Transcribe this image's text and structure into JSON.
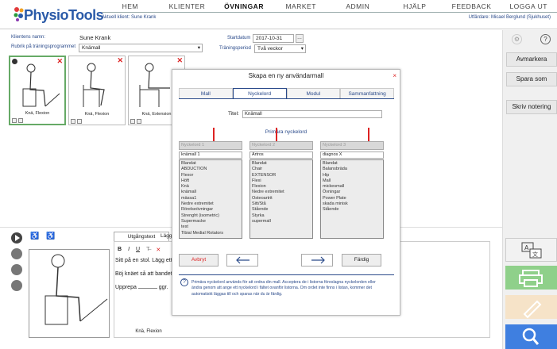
{
  "header": {
    "logo_text": "PhysioTools",
    "nav": [
      "HEM",
      "KLIENTER",
      "ÖVNINGAR",
      "MARKET",
      "ADMIN",
      "HJÄLP",
      "FEEDBACK",
      "LOGGA UT"
    ],
    "active_nav": "ÖVNINGAR",
    "active_client": "Aktuell klient: Sune Krank",
    "performer": "Utfärdare: Micael Berglund (Sjukhuset)"
  },
  "form": {
    "client_name_label": "Klientens namn:",
    "client_name_value": "Sune Krank",
    "title_label": "Rubrik på träningsprogrammet",
    "title_value": "Knämall",
    "start_date_label": "Startdatum",
    "start_date_value": "2017-10-31",
    "period_label": "Träningsperiod",
    "period_value": "Två veckor"
  },
  "cards": [
    {
      "caption": "Knä, Flexion",
      "selected": true
    },
    {
      "caption": "Knä, Flexion",
      "selected": false
    },
    {
      "caption": "Knä, Extension",
      "selected": false
    }
  ],
  "right_panel": {
    "buttons": [
      "Avmarkera",
      "Spara som",
      "Skriv notering"
    ]
  },
  "modal": {
    "title": "Skapa en ny användarmall",
    "close": "×",
    "tabs": [
      "Mall",
      "Nyckelord",
      "Modul",
      "Sammanfattning"
    ],
    "active_tab": "Nyckelord",
    "titel_label": "Titel:",
    "titel_value": "Knämall",
    "primary_keywords": "Primära nyckelord",
    "columns": [
      {
        "header": "Nyckelord 1",
        "input": "knämall 1",
        "items": [
          "Blandat",
          "ABDUCTION",
          "Flexor",
          "Höft",
          "Knä",
          "knämall",
          "mässa1",
          "Nedre extremitet",
          "Rörelseövningar",
          "Strenght (isometric)",
          "Supermacke",
          "test",
          "Tibial Medial Rotators"
        ]
      },
      {
        "header": "Nyckelord 2",
        "input": "Artros",
        "items": [
          "Blandat",
          "Chair",
          "EXTENSOR",
          "Flexi",
          "Flexion",
          "Nedre extremitet",
          "Osteoartrit",
          "Sitt/Stå",
          "Stående",
          "Styrka",
          "supermall"
        ]
      },
      {
        "header": "Nyckelord 3",
        "input": "diagnos X",
        "items": [
          "Blandat",
          "Balansbräda",
          "Hip",
          "Mall",
          "mickesmall",
          "Övningar",
          "Power Plate",
          "skada minisk",
          "Stående"
        ]
      }
    ],
    "cancel": "Avbryt",
    "finish": "Färdig",
    "help": "Primära nyckelord används för att ordna din mall. Acceptera de i listorna föreslagna nyckelorden eller ändra genom att ange ett nyckelord i fältet ovanför listorna. Om ordet inte finns i listan, kommer det automatiskt läggas till och sparas när du är färdig."
  },
  "editor": {
    "tab_instructions": "Utgångstext",
    "tab_more": "Lägg",
    "line1": "Sitt på en stol. Lägg ett",
    "line2": "Böj knäet så att bandet",
    "line3_a": "Upprepa",
    "line3_b": "ggr.",
    "image_caption": "Knä, Flexion"
  },
  "colors": {
    "brand": "#2a5aa8",
    "accent_green": "#8fd08a",
    "accent_peach": "#f6e3c8",
    "accent_blue": "#3f7fe0",
    "danger": "#d22222"
  }
}
